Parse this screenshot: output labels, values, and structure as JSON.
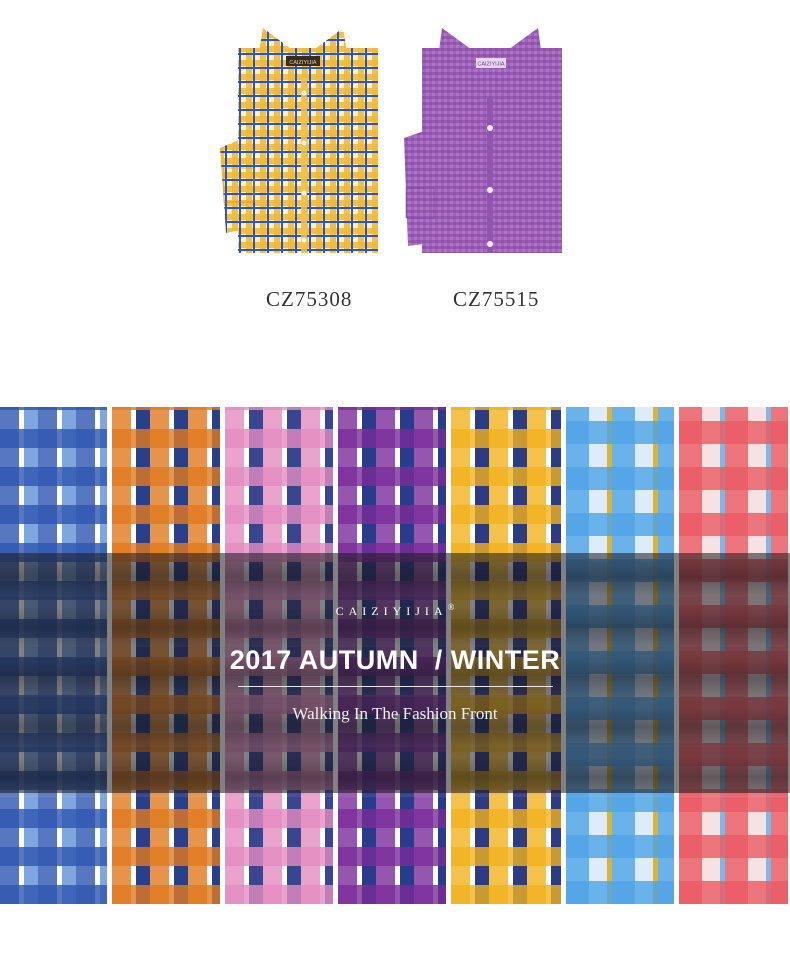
{
  "products": [
    {
      "sku": "CZ75308",
      "label": "CAIZIYIJIA",
      "colors": {
        "base": "#f2c84b",
        "line1": "#2f55b5",
        "line2": "#e8a21a",
        "light": "#fbf5dc"
      }
    },
    {
      "sku": "CZ75515",
      "label": "CAIZIYIJIA",
      "colors": {
        "base": "#9b5fb8",
        "line1": "#7a3e99",
        "line2": "#b57fd0",
        "light": "#e9d9f3"
      }
    }
  ],
  "banner": {
    "brand": "CAIZIYIJIA",
    "brand_mark": "®",
    "headline": "2017 AUTUMN  / WINTER",
    "tagline": "Walking In The Fashion Front"
  },
  "swatches": [
    {
      "name": "blue-check",
      "c1": "#2d56b0",
      "c2": "#ffffff",
      "c3": "#7fa6dd"
    },
    {
      "name": "orange-navy-check",
      "c1": "#e07a1f",
      "c2": "#ffffff",
      "c3": "#2a3f8a"
    },
    {
      "name": "pink-navy-check",
      "c1": "#e48cc0",
      "c2": "#ffffff",
      "c3": "#3a4592"
    },
    {
      "name": "purple-navy-check",
      "c1": "#7a2c9a",
      "c2": "#ffffff",
      "c3": "#2b3b8c"
    },
    {
      "name": "yellow-navy-check",
      "c1": "#f2b21e",
      "c2": "#ffffff",
      "c3": "#2d3b82"
    },
    {
      "name": "light-blue-plaid",
      "c1": "#4ea3e6",
      "c2": "#dcecfb",
      "c3": "#d9b43c"
    },
    {
      "name": "red-blue-plaid",
      "c1": "#ea5a63",
      "c2": "#f7e1e3",
      "c3": "#7fb8e8"
    }
  ]
}
